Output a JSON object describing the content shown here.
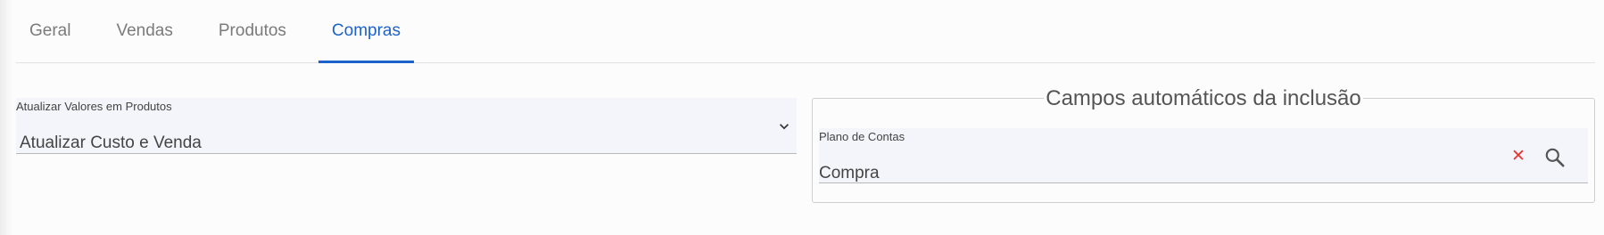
{
  "tabs": [
    {
      "label": "Geral",
      "active": false
    },
    {
      "label": "Vendas",
      "active": false
    },
    {
      "label": "Produtos",
      "active": false
    },
    {
      "label": "Compras",
      "active": true
    }
  ],
  "update_values": {
    "label": "Atualizar Valores em Produtos",
    "value": "Atualizar Custo e Venda",
    "icon": "chevron-down-icon"
  },
  "auto_fields": {
    "title": "Campos automáticos da inclusão",
    "plano_de_contas": {
      "label": "Plano de Contas",
      "value": "Compra",
      "clear_icon": "close-icon",
      "search_icon": "search-icon"
    }
  },
  "colors": {
    "accent": "#1d62c9",
    "clear": "#e53935",
    "field_bg": "#f4f4fb"
  }
}
